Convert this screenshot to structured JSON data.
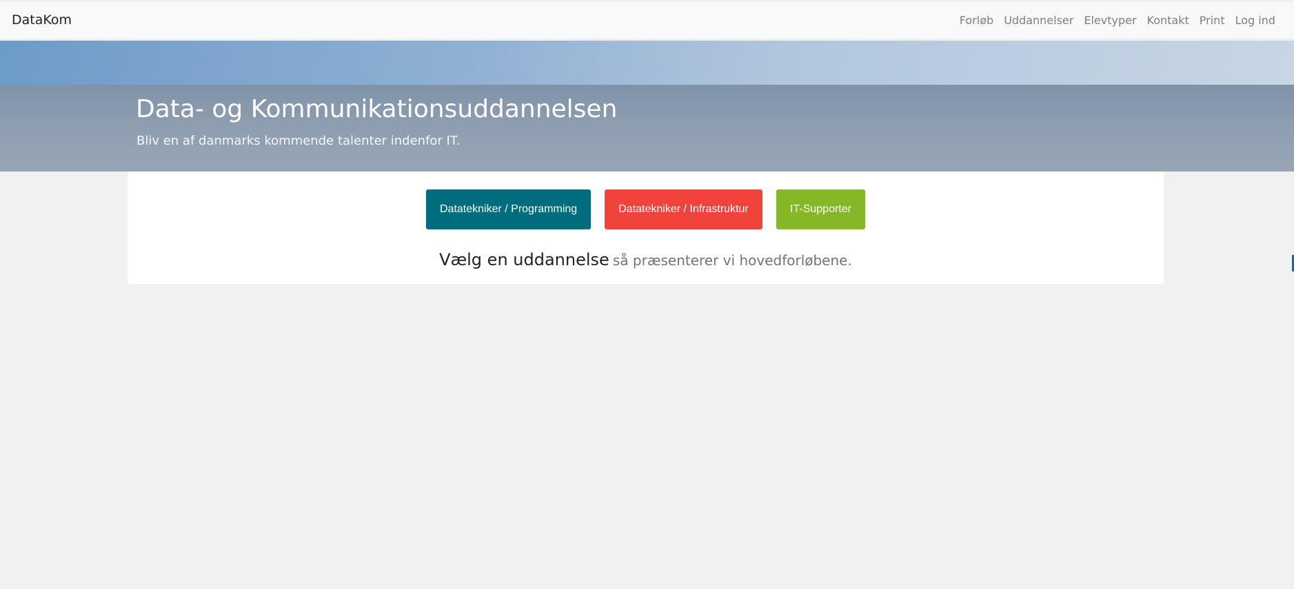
{
  "navbar": {
    "brand": "DataKom",
    "links": [
      "Forløb",
      "Uddannelser",
      "Elevtyper",
      "Kontakt",
      "Print",
      "Log ind"
    ]
  },
  "hero": {
    "title": "Data- og Kommunikationsuddannelsen",
    "subtitle": "Bliv en af danmarks kommende talenter indenfor IT."
  },
  "education_buttons": [
    {
      "label": "Datatekniker / Programming",
      "color": "#006d7f"
    },
    {
      "label": "Datatekniker / Infrastruktur",
      "color": "#f1433b"
    },
    {
      "label": "IT-Supporter",
      "color": "#86b726"
    }
  ],
  "prompt": {
    "strong": "Vælg en uddannelse",
    "rest": "så præsenterer vi hovedforløbene."
  },
  "colors": {
    "page_background": "#f1f1f1",
    "navbar_background": "#f8f9fa",
    "nav_link": "#7b7f83"
  }
}
